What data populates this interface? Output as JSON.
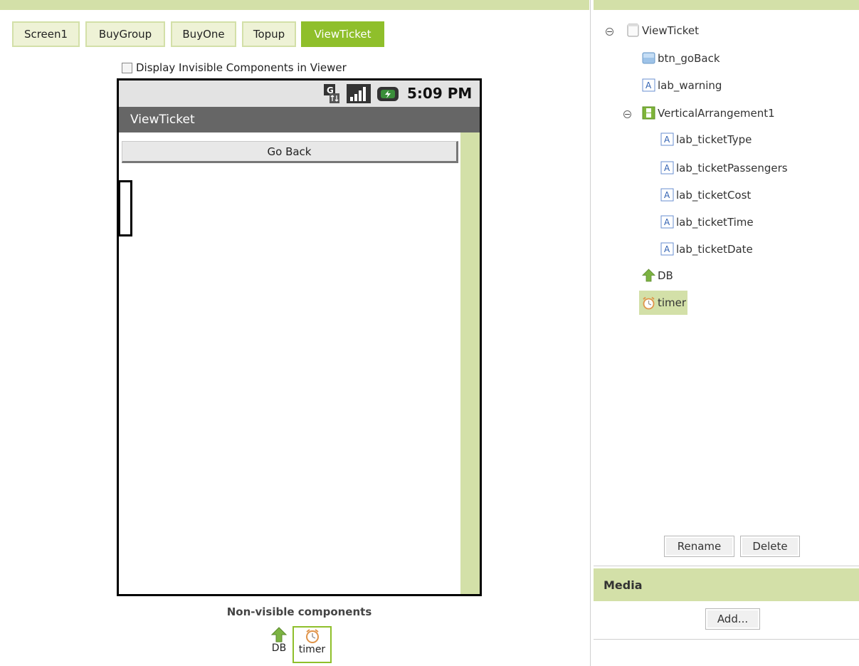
{
  "screen_tabs": [
    "Screen1",
    "BuyGroup",
    "BuyOne",
    "Topup",
    "ViewTicket"
  ],
  "active_tab": "ViewTicket",
  "viewer": {
    "display_invisible_label": "Display Invisible Components in Viewer",
    "status_time": "5:09 PM",
    "screen_title": "ViewTicket",
    "go_back_label": "Go Back"
  },
  "non_visible": {
    "title": "Non-visible components",
    "items": [
      {
        "label": "DB",
        "icon": "upload-arrow-icon"
      },
      {
        "label": "timer",
        "icon": "clock-icon"
      }
    ]
  },
  "tree": {
    "root": "ViewTicket",
    "btn_goBack": "btn_goBack",
    "lab_warning": "lab_warning",
    "vertical": "VerticalArrangement1",
    "lab_ticketType": "lab_ticketType",
    "lab_ticketPassengers": "lab_ticketPassengers",
    "lab_ticketCost": "lab_ticketCost",
    "lab_ticketTime": "lab_ticketTime",
    "lab_ticketDate": "lab_ticketDate",
    "db": "DB",
    "timer": "timer"
  },
  "actions": {
    "rename": "Rename",
    "delete": "Delete"
  },
  "media": {
    "title": "Media",
    "add_label": "Add..."
  },
  "colors": {
    "accent_green": "#8fbf2b",
    "light_green": "#d3e0a8",
    "titlebar_gray": "#666666"
  }
}
